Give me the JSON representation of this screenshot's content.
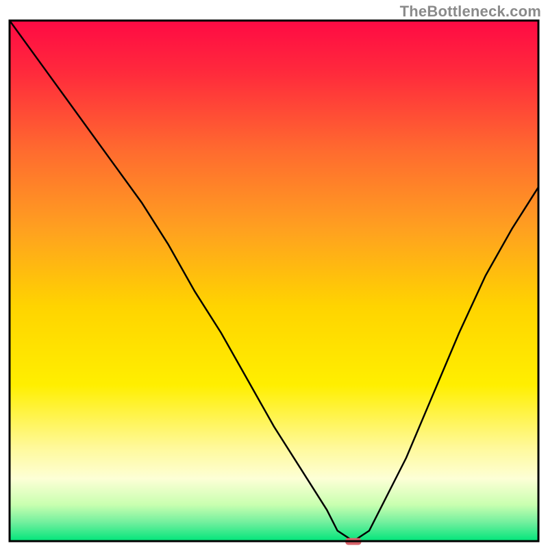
{
  "watermark": "TheBottleneck.com",
  "chart_data": {
    "type": "line",
    "title": "",
    "xlabel": "",
    "ylabel": "",
    "xlim": [
      0,
      100
    ],
    "ylim": [
      0,
      100
    ],
    "x": [
      0,
      5,
      10,
      15,
      20,
      25,
      30,
      35,
      40,
      45,
      50,
      55,
      60,
      62,
      65,
      68,
      70,
      75,
      80,
      85,
      90,
      95,
      100
    ],
    "values": [
      100,
      93,
      86,
      79,
      72,
      65,
      57,
      48,
      40,
      31,
      22,
      14,
      6,
      2,
      0,
      2,
      6,
      16,
      28,
      40,
      51,
      60,
      68
    ],
    "series": [
      {
        "name": "bottleneck-curve",
        "x": [
          0,
          5,
          10,
          15,
          20,
          25,
          30,
          35,
          40,
          45,
          50,
          55,
          60,
          62,
          65,
          68,
          70,
          75,
          80,
          85,
          90,
          95,
          100
        ],
        "values": [
          100,
          93,
          86,
          79,
          72,
          65,
          57,
          48,
          40,
          31,
          22,
          14,
          6,
          2,
          0,
          2,
          6,
          16,
          28,
          40,
          51,
          60,
          68
        ]
      }
    ],
    "marker": {
      "x": 65,
      "y": 0,
      "width": 3,
      "height": 1.2,
      "color": "#d9636a"
    },
    "gradient_stops": [
      {
        "offset": 0.0,
        "color": "#ff0a44"
      },
      {
        "offset": 0.1,
        "color": "#ff2a3c"
      },
      {
        "offset": 0.25,
        "color": "#ff6b2f"
      },
      {
        "offset": 0.4,
        "color": "#ffa020"
      },
      {
        "offset": 0.55,
        "color": "#ffd400"
      },
      {
        "offset": 0.7,
        "color": "#ffef00"
      },
      {
        "offset": 0.82,
        "color": "#fff99a"
      },
      {
        "offset": 0.88,
        "color": "#fdffd6"
      },
      {
        "offset": 0.93,
        "color": "#c9ffb0"
      },
      {
        "offset": 0.965,
        "color": "#6fef9d"
      },
      {
        "offset": 1.0,
        "color": "#00e57a"
      }
    ],
    "frame_color": "#000000",
    "curve_color": "#000000"
  }
}
